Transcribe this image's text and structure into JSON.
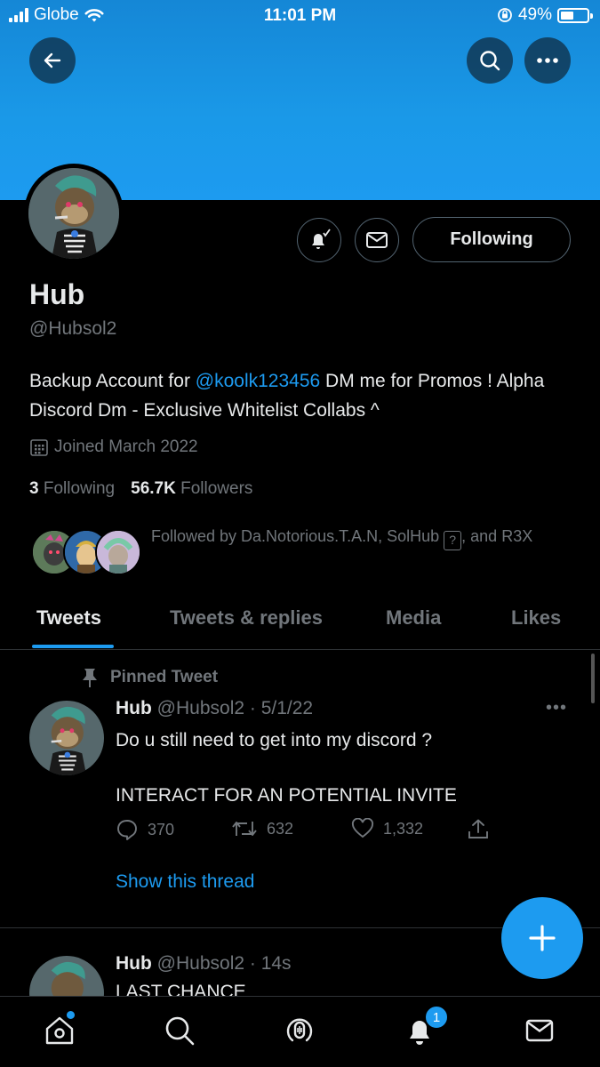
{
  "status_bar": {
    "carrier": "Globe",
    "time": "11:01 PM",
    "battery": "49%"
  },
  "profile": {
    "name": "Hub",
    "handle": "@Hubsol2",
    "bio_prefix": "Backup Account for ",
    "bio_mention": "@koolk123456",
    "bio_suffix": " DM me for Promos ! Alpha Discord Dm - Exclusive Whitelist Collabs ^",
    "joined": "Joined March 2022",
    "following_count": "3",
    "following_label": "Following",
    "followers_count": "56.7K",
    "followers_label": "Followers",
    "followed_by_prefix": "Followed by Da.Notorious.T.A.N, SolHub ",
    "followed_by_glyph": "?",
    "followed_by_suffix": ", and R3X",
    "follow_button": "Following"
  },
  "tabs": [
    {
      "label": "Tweets",
      "active": true
    },
    {
      "label": "Tweets & replies",
      "active": false
    },
    {
      "label": "Media",
      "active": false
    },
    {
      "label": "Likes",
      "active": false
    }
  ],
  "pinned_tweet": {
    "pinned_label": "Pinned Tweet",
    "name": "Hub",
    "handle_date": "@Hubsol2 · 5/1/22",
    "line1": "Do u still need to get into my discord ?",
    "line2": "INTERACT FOR AN  POTENTIAL INVITE",
    "replies": "370",
    "retweets": "632",
    "likes": "1,332",
    "show_thread": "Show this thread"
  },
  "second_tweet": {
    "name": "Hub",
    "handle_time": "@Hubsol2 · 14s",
    "text": "LAST CHANCE"
  },
  "notifications_badge": "1",
  "colors": {
    "accent": "#1d9bf0",
    "background": "#000000",
    "muted": "#71767b",
    "banner": "#1d9bf0"
  },
  "icons": [
    "back-arrow-icon",
    "search-icon",
    "more-icon",
    "bell-icon",
    "mail-icon",
    "calendar-icon",
    "pin-icon",
    "reply-icon",
    "retweet-icon",
    "like-icon",
    "share-icon",
    "compose-icon",
    "home-icon",
    "spaces-icon",
    "notifications-icon",
    "messages-icon"
  ]
}
